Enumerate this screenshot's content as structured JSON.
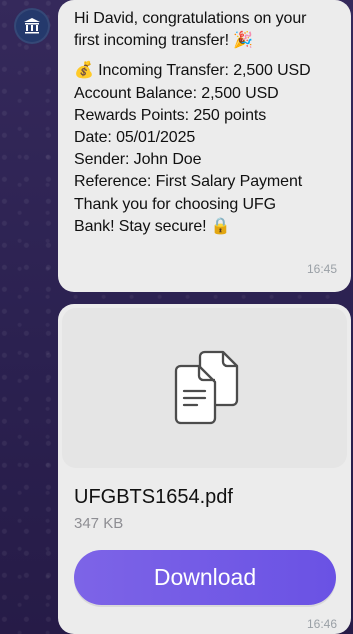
{
  "colors": {
    "background": "#2b2150",
    "bubble": "#ececec",
    "accent": "#7d64e7",
    "timestamp": "#9aa0a6",
    "avatar": "#24396c"
  },
  "sender_avatar": {
    "icon": "bank-icon"
  },
  "message": {
    "lines": [
      "Hi David, congratulations on your",
      "first incoming transfer! 🎉",
      "💰 Incoming Transfer: 2,500 USD",
      "Account Balance: 2,500 USD",
      "Rewards Points: 250 points",
      "Date: 05/01/2025",
      "Sender: John Doe",
      "Reference: First Salary Payment",
      "Thank you for choosing UFG",
      "Bank! Stay secure! 🔒"
    ],
    "time": "16:45"
  },
  "attachment": {
    "icon": "document-icon",
    "file_name": "UFGBTS1654.pdf",
    "file_size": "347 KB",
    "button_label": "Download",
    "time": "16:46"
  }
}
